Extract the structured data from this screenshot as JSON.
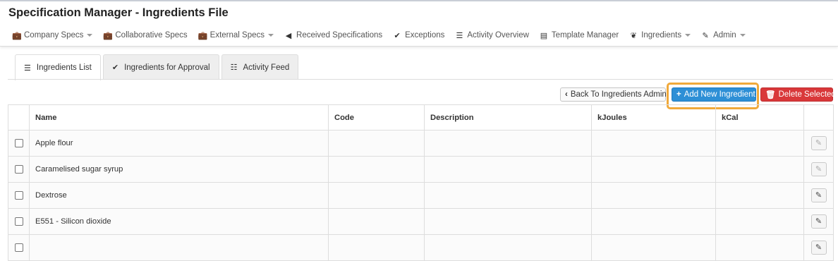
{
  "app": {
    "title": "Specification Manager - Ingredients File"
  },
  "nav": {
    "items": [
      {
        "label": "Company Specs",
        "icon": "briefcase-icon",
        "glyph": "💼",
        "dropdown": true
      },
      {
        "label": "Collaborative Specs",
        "icon": "briefcase-icon",
        "glyph": "💼",
        "dropdown": false
      },
      {
        "label": "External Specs",
        "icon": "briefcase-icon",
        "glyph": "💼",
        "dropdown": true
      },
      {
        "label": "Received Specifications",
        "icon": "arrow-left-icon",
        "glyph": "◀",
        "dropdown": false
      },
      {
        "label": "Exceptions",
        "icon": "check-circle-icon",
        "glyph": "✔",
        "dropdown": false
      },
      {
        "label": "Activity Overview",
        "icon": "list-icon",
        "glyph": "☰",
        "dropdown": false
      },
      {
        "label": "Template Manager",
        "icon": "document-icon",
        "glyph": "▤",
        "dropdown": false
      },
      {
        "label": "Ingredients",
        "icon": "leaf-icon",
        "glyph": "❦",
        "dropdown": true
      },
      {
        "label": "Admin",
        "icon": "wrench-icon",
        "glyph": "✎",
        "dropdown": true
      }
    ]
  },
  "tabs": [
    {
      "label": "Ingredients List",
      "icon": "list-icon",
      "glyph": "☰",
      "active": true
    },
    {
      "label": "Ingredients for Approval",
      "icon": "check-icon",
      "glyph": "✔",
      "active": false
    },
    {
      "label": "Activity Feed",
      "icon": "feed-icon",
      "glyph": "☷",
      "active": false
    }
  ],
  "toolbar": {
    "back_label": "Back To Ingredients Admin",
    "add_label": "Add New Ingredient",
    "delete_label": "Delete Selected"
  },
  "table": {
    "headers": [
      "",
      "Name",
      "Code",
      "Description",
      "kJoules",
      "kCal",
      ""
    ],
    "rows": [
      {
        "name": "Apple flour",
        "code": "",
        "description": "",
        "kjoules": "",
        "kcal": "",
        "edit_enabled": false
      },
      {
        "name": "Caramelised sugar syrup",
        "code": "",
        "description": "",
        "kjoules": "",
        "kcal": "",
        "edit_enabled": false
      },
      {
        "name": "Dextrose",
        "code": "",
        "description": "",
        "kjoules": "",
        "kcal": "",
        "edit_enabled": true
      },
      {
        "name": "E551 - Silicon dioxide",
        "code": "",
        "description": "",
        "kjoules": "",
        "kcal": "",
        "edit_enabled": true
      },
      {
        "name": "",
        "code": "",
        "description": "",
        "kjoules": "",
        "kcal": "",
        "edit_enabled": true
      }
    ]
  },
  "colors": {
    "primary": "#2d8fd6",
    "danger": "#d9383a",
    "highlight": "#f0a93a"
  }
}
